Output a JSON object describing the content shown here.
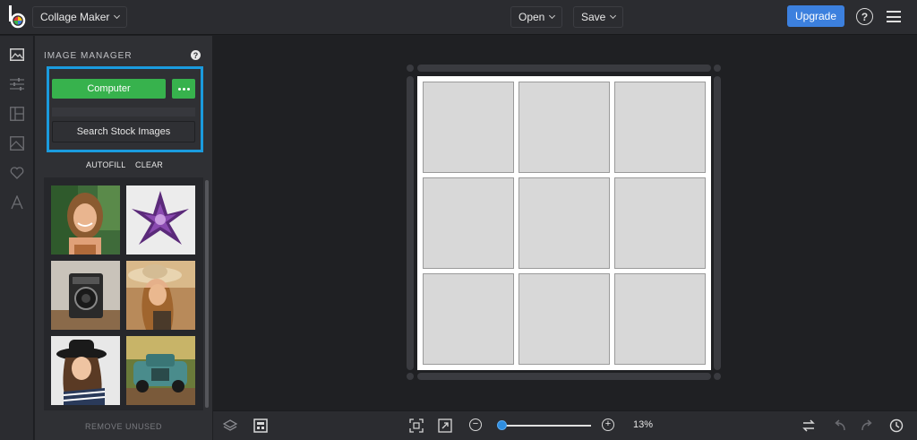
{
  "header": {
    "app_label": "Collage Maker",
    "open_label": "Open",
    "save_label": "Save",
    "upgrade_label": "Upgrade",
    "help_glyph": "?"
  },
  "rail": {
    "icons": [
      "image-icon",
      "sliders-icon",
      "layout-icon",
      "background-icon",
      "heart-icon",
      "text-icon"
    ]
  },
  "panel": {
    "title": "IMAGE MANAGER",
    "help_glyph": "?",
    "computer_label": "Computer",
    "stock_label": "Search Stock Images",
    "autofill_label": "AUTOFILL",
    "clear_label": "CLEAR",
    "remove_unused_label": "REMOVE UNUSED",
    "thumbnails": [
      "portrait-woman-greenery",
      "purple-succulent-flower",
      "vintage-camera",
      "woman-straw-hat",
      "woman-black-hat",
      "vintage-blue-truck"
    ]
  },
  "canvas": {
    "grid_rows": 3,
    "grid_cols": 3
  },
  "footer": {
    "zoom_label": "13%",
    "zoom_minus": "−",
    "zoom_plus": "+",
    "zoom_level": 0.05
  },
  "colors": {
    "accent_green": "#37b24d",
    "accent_blue": "#3c80de",
    "highlight_blue": "#1a9bde"
  }
}
